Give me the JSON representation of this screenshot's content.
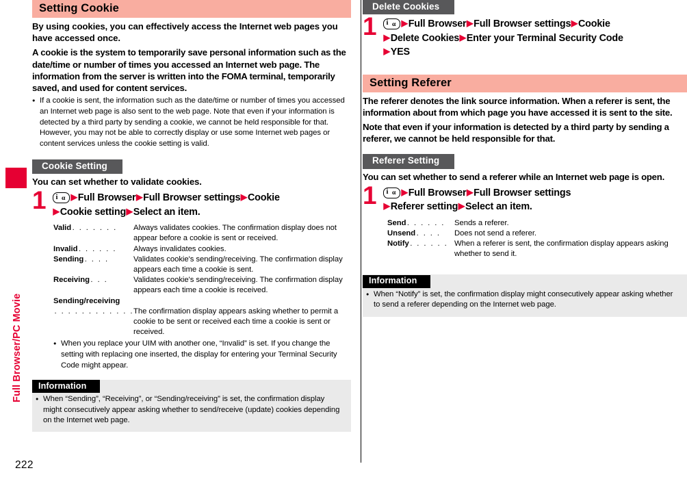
{
  "page": {
    "number": "222",
    "side_tab_label": "Full Browser/PC Movie"
  },
  "icons": {
    "function_key_i": "i",
    "function_key_alpha": "α",
    "arrow": "▶",
    "bullet": "●"
  },
  "left_column": {
    "section_title": "Setting Cookie",
    "lead_paragraphs": [
      "By using cookies, you can effectively access the Internet web pages you have accessed once.",
      "A cookie is the system to temporarily save personal information such as the date/time or number of times you accessed an Internet web page. The information from the server is written into the FOMA terminal, temporarily saved, and used for content services."
    ],
    "lead_bullet": "If a cookie is sent, the information such as the date/time or number of times you accessed an Internet web page is also sent to the web page. Note that even if your information is detected by a third party by sending a cookie, we cannot be held responsible for that. However, you may not be able to correctly display or use some Internet web pages or content services unless the cookie setting is valid.",
    "subsection_title": "Cookie Setting",
    "subsection_lead": "You can set whether to validate cookies.",
    "step": {
      "number": "1",
      "line1_parts": [
        "Full Browser",
        "Full Browser settings",
        "Cookie"
      ],
      "line2_parts": [
        "Cookie setting",
        "Select an item."
      ]
    },
    "definitions": [
      {
        "term": "Valid",
        "dots": ". . . . . . .",
        "desc": "Always validates cookies. The confirmation display does not appear before a cookie is sent or received."
      },
      {
        "term": "Invalid",
        "dots": ". . . . . .",
        "desc": "Always invalidates cookies."
      },
      {
        "term": "Sending",
        "dots": ". . . .",
        "desc": "Validates cookie's sending/receiving. The confirmation display appears each time a cookie is sent."
      },
      {
        "term": "Receiving",
        "dots": ". . .",
        "desc": "Validates cookie's sending/receiving. The confirmation display appears each time a cookie is received."
      }
    ],
    "definition_wrapped": {
      "term": "Sending/receiving",
      "dots": ". . . . . . . . . . . .",
      "desc": "The confirmation display appears asking whether to permit a cookie to be sent or received each time a cookie is sent or received."
    },
    "note_bullet": "When you replace your UIM with another one, “Invalid” is set. If you change the setting with replacing one inserted, the display for entering your Terminal Security Code might appear.",
    "information": {
      "header": "Information",
      "body": "When “Sending”, “Receiving”, or “Sending/receiving” is set, the confirmation display might consecutively appear asking whether to send/receive (update) cookies depending on the Internet web page."
    }
  },
  "right_column": {
    "subsection_title_delete": "Delete Cookies",
    "step_delete": {
      "number": "1",
      "line1_parts": [
        "Full Browser",
        "Full Browser settings",
        "Cookie"
      ],
      "line2_parts": [
        "Delete Cookies",
        "Enter your Terminal Security Code"
      ],
      "line3_parts": [
        "YES"
      ]
    },
    "section_title": "Setting Referer",
    "lead_paragraphs": [
      "The referer denotes the link source information. When a referer is sent, the information about from which page you have accessed it is sent to the site.",
      "Note that even if your information is detected by a third party by sending a referer, we cannot be held responsible for that."
    ],
    "subsection_title": "Referer Setting",
    "subsection_lead": "You can set whether to send a referer while an Internet web page is open.",
    "step": {
      "number": "1",
      "line1_parts": [
        "Full Browser",
        "Full Browser settings"
      ],
      "line2_parts": [
        "Referer setting",
        "Select an item."
      ]
    },
    "definitions": [
      {
        "term": "Send",
        "dots": ". . . . . .",
        "desc": "Sends a referer."
      },
      {
        "term": "Unsend",
        "dots": ". . . .",
        "desc": "Does not send a referer."
      },
      {
        "term": "Notify",
        "dots": ". . . . . .",
        "desc": "When a referer is sent, the confirmation display appears asking whether to send it."
      }
    ],
    "information": {
      "header": "Information",
      "body": "When “Notify” is set, the confirmation display might consecutively appear asking whether to send a referer depending on the Internet web page."
    }
  },
  "colors": {
    "accent_red": "#E60033",
    "heading_pink": "#F9ADA0",
    "subheading_gray": "#58585A",
    "info_bg": "#EAEAEA",
    "info_head_bg": "#000000"
  }
}
